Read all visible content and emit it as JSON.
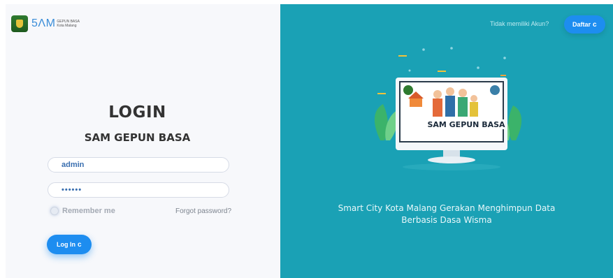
{
  "logo": {
    "brand": "5ΛM",
    "sub_line1": "GEPUN BASA",
    "sub_line2": "Kota Malang"
  },
  "login": {
    "title": "LOGIN",
    "app_name": "SAM GEPUN BASA",
    "username_value": "admin",
    "password_value": "••••••",
    "remember_label": "Remember me",
    "forgot_label": "Forgot password?",
    "submit_label": "Log In",
    "submit_icon": "c"
  },
  "signup": {
    "prompt": "Tidak memiliki Akun?",
    "button_label": "Daftar",
    "button_icon": "c"
  },
  "hero": {
    "screen_caption": "SAM GEPUN BASA",
    "tagline_line1": "Smart City Kota Malang Gerakan Menghimpun Data",
    "tagline_line2": "Berbasis Dasa Wisma"
  },
  "colors": {
    "accent": "#1d8df0",
    "panel": "#1aa1b5",
    "left_bg": "#f7f8fb"
  }
}
